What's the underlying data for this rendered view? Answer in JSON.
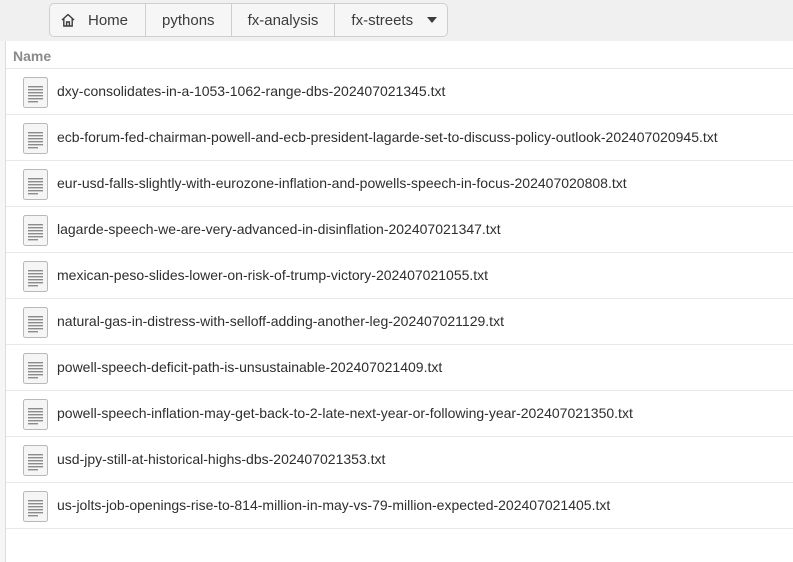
{
  "breadcrumb": {
    "home_label": "Home",
    "items": [
      "pythons",
      "fx-analysis",
      "fx-streets"
    ]
  },
  "list": {
    "column_name": "Name",
    "files": [
      "dxy-consolidates-in-a-1053-1062-range-dbs-202407021345.txt",
      "ecb-forum-fed-chairman-powell-and-ecb-president-lagarde-set-to-discuss-policy-outlook-202407020945.txt",
      "eur-usd-falls-slightly-with-eurozone-inflation-and-powells-speech-in-focus-202407020808.txt",
      "lagarde-speech-we-are-very-advanced-in-disinflation-202407021347.txt",
      "mexican-peso-slides-lower-on-risk-of-trump-victory-202407021055.txt",
      "natural-gas-in-distress-with-selloff-adding-another-leg-202407021129.txt",
      "powell-speech-deficit-path-is-unsustainable-202407021409.txt",
      "powell-speech-inflation-may-get-back-to-2-late-next-year-or-following-year-202407021350.txt",
      "usd-jpy-still-at-historical-highs-dbs-202407021353.txt",
      "us-jolts-job-openings-rise-to-814-million-in-may-vs-79-million-expected-202407021405.txt"
    ]
  },
  "icons": {
    "home": "home-icon",
    "dropdown": "chevron-down-icon",
    "file": "text-file-icon"
  }
}
